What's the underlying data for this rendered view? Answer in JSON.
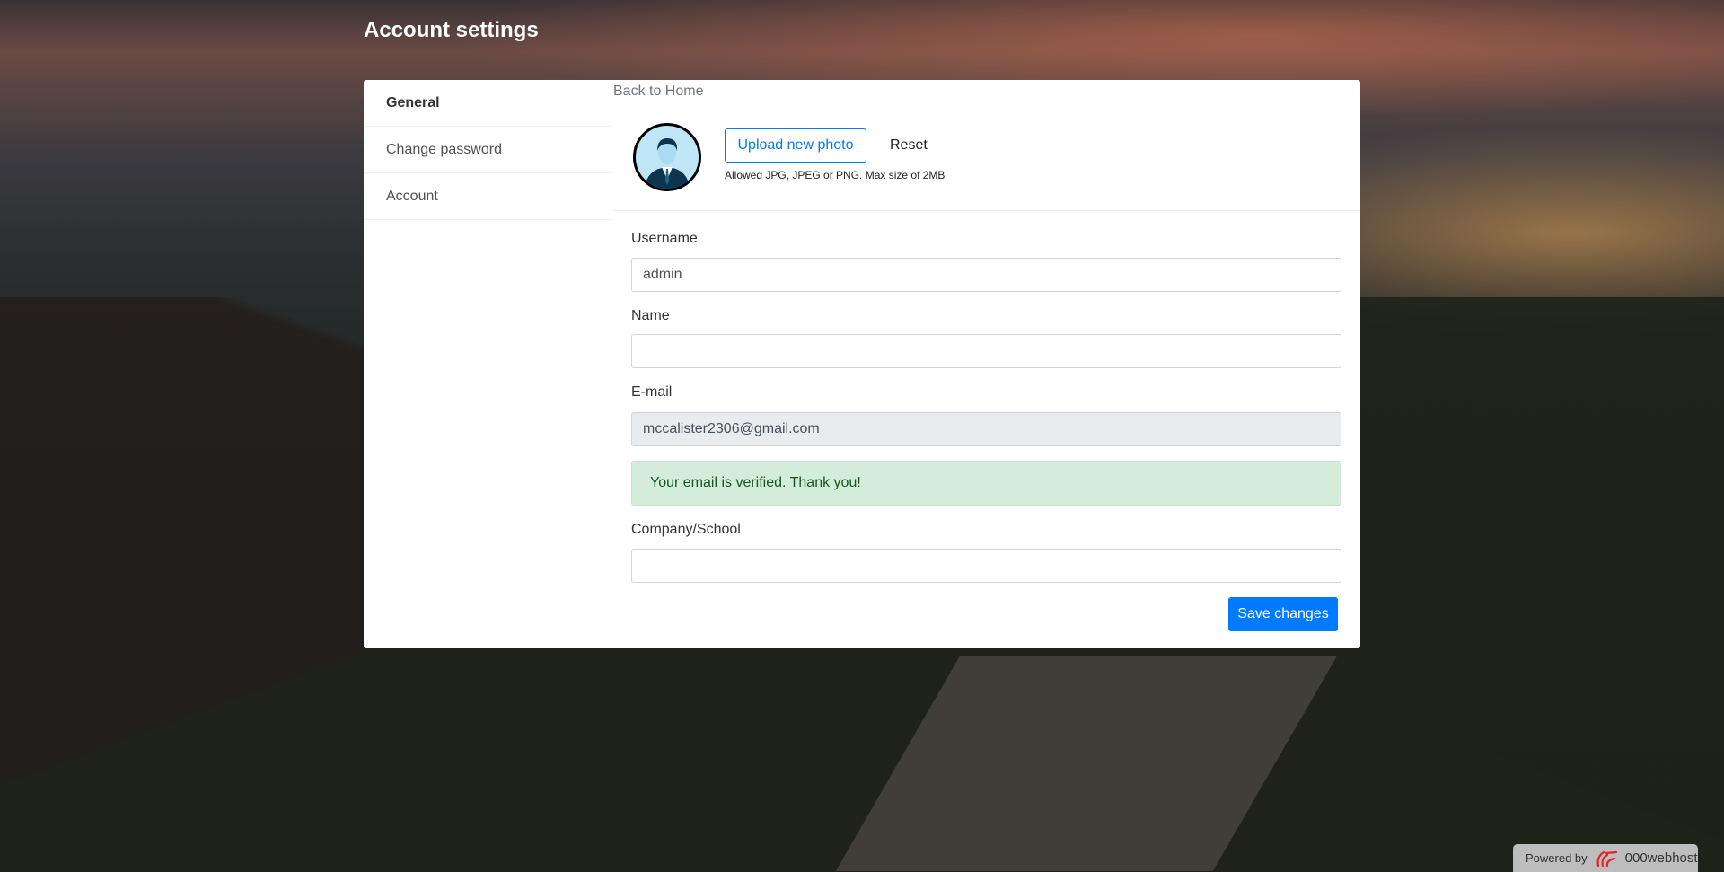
{
  "page_title": "Account settings",
  "sidebar": {
    "items": [
      {
        "label": "General"
      },
      {
        "label": "Change password"
      },
      {
        "label": "Account"
      }
    ]
  },
  "back_link": "Back to Home",
  "photo": {
    "upload_label": "Upload new photo",
    "reset_label": "Reset",
    "hint": "Allowed JPG, JPEG or PNG. Max size of 2MB"
  },
  "form": {
    "username": {
      "label": "Username",
      "value": "admin"
    },
    "name": {
      "label": "Name",
      "value": ""
    },
    "email": {
      "label": "E-mail",
      "value": "mccalister2306@gmail.com"
    },
    "verified_alert": "Your email is verified. Thank you!",
    "company": {
      "label": "Company/School",
      "value": ""
    },
    "save_label": "Save changes"
  },
  "footer_badge": {
    "powered_by": "Powered by",
    "brand": "000webhost"
  }
}
